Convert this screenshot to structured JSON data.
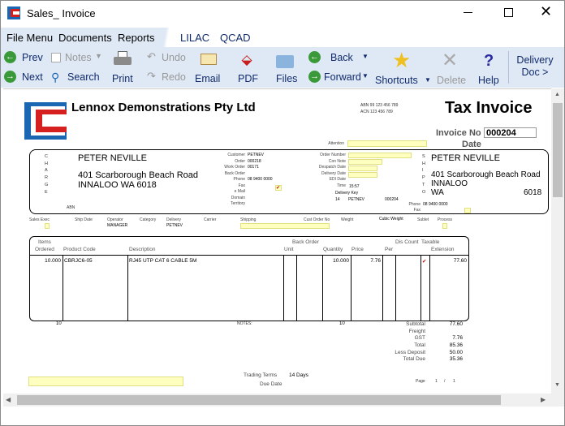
{
  "window": {
    "title": "Sales_ Invoice"
  },
  "menu": [
    "File Menu",
    "Documents",
    "Reports",
    "LILAC",
    "QCAD"
  ],
  "toolbar": {
    "prev": "Prev",
    "next": "Next",
    "notes": "Notes",
    "search": "Search",
    "print": "Print",
    "undo": "Undo",
    "redo": "Redo",
    "email": "Email",
    "pdf": "PDF",
    "files": "Files",
    "back": "Back",
    "forward": "Forward",
    "shortcuts": "Shortcuts",
    "delete": "Delete",
    "help": "Help",
    "delivery": "Delivery",
    "doc": "Doc >"
  },
  "invoice": {
    "company": "Lennox Demonstrations Pty Ltd",
    "abn": "ABN 99 123 456 789",
    "acn": "ACN 123 456 789",
    "title": "Tax Invoice",
    "invoice_no_label": "Invoice No",
    "invoice_no": "000204",
    "date_label": "Date",
    "attention_label": "Attention",
    "charge_letters": [
      "C",
      "H",
      "A",
      "R",
      "G",
      "E"
    ],
    "ship_letters": [
      "S",
      "H",
      "I",
      "P",
      "T",
      "O"
    ],
    "charge_name": "PETER NEVILLE",
    "charge_addr1": "401 Scarborough Beach Road",
    "charge_addr2": "INNALOO WA 6018",
    "ship_name": "PETER NEVILLE",
    "ship_addr1": "401 Scarborough Beach Road",
    "ship_addr2": "INNALOO",
    "ship_addr3": "WA",
    "ship_postcode": "6018",
    "abn_label": "ABN",
    "mid_labels": [
      "Customer",
      "Order",
      "Work Order",
      "Back Order",
      "Phone",
      "Fax",
      "e Mail",
      "Domain",
      "Territory"
    ],
    "mid_values": [
      "PETNEV",
      "000218",
      "00171",
      "",
      "08 9400 0000",
      "",
      "",
      "",
      ""
    ],
    "fax_tick": "✔",
    "right_labels": [
      "Order Number",
      "Con Note",
      "Despatch Date",
      "Delivery Date",
      "EDI Date",
      "Time"
    ],
    "time_value": "15:57",
    "delivery_key_label": "Delivery Key",
    "delivery_key_values": [
      "14",
      "PETNEV",
      "000204"
    ],
    "ship_phone_label": "Phone",
    "ship_phone": "08 9400 0000",
    "ship_fax_label": "Fax",
    "info_labels": [
      "Sales Exec",
      "Ship Date",
      "Operator",
      "Category",
      "Delivery",
      "Carrier",
      "Shipping",
      "Cust Order No",
      "Weight",
      "Cubic Weight",
      "Sublet",
      "Process"
    ],
    "operator": "MANAGER",
    "delivery_value": "PETNEV",
    "table_headers": {
      "items": "Items",
      "ordered": "Ordered",
      "product_code": "Product Code",
      "description": "Description",
      "back_order": "Back Order",
      "unit": "Unit",
      "quantity": "Quantity",
      "price": "Price",
      "disc": "Dis Count",
      "per": "Per",
      "taxable": "Taxable",
      "extension": "Extension"
    },
    "line": {
      "ordered": "10.000",
      "code": "CBRJC6-05",
      "description": "RJ45 UTP CAT 6 CABLE 5M",
      "quantity": "10.000",
      "price": "7.76",
      "taxable": "✔",
      "extension": "77.60"
    },
    "total_ordered": "10",
    "notes_label": "NOTES:",
    "total_qty": "10",
    "totals": [
      [
        "Subtotal",
        "77.60"
      ],
      [
        "Freight",
        ""
      ],
      [
        "GST",
        "7.76"
      ],
      [
        "Total",
        "85.36"
      ],
      [
        "Less Deposit",
        "50.00"
      ],
      [
        "Total Due",
        "35.36"
      ]
    ],
    "trading_terms_label": "Trading Terms",
    "trading_terms": "14 Days",
    "due_date_label": "Due Date",
    "page_label": "Page",
    "page_num": "1",
    "page_sep": "/",
    "page_total": "1"
  },
  "colors": {
    "toolbar": "#dfe9f5",
    "field_yellow": "#ffffc0",
    "logo_blue": "#1b66b3",
    "logo_red": "#d62020"
  }
}
